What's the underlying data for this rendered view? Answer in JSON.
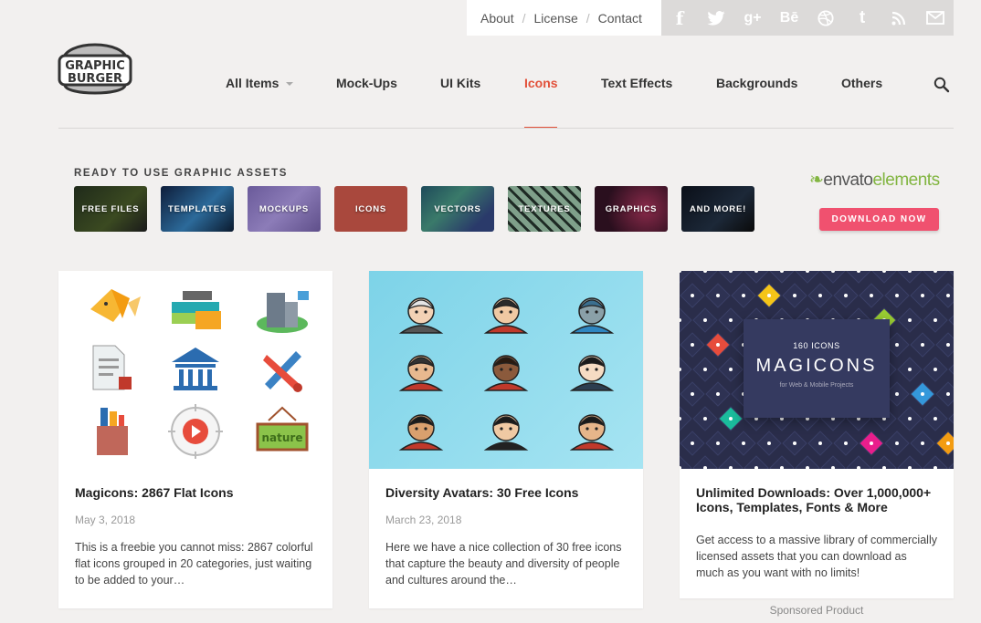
{
  "top_links": [
    "About",
    "License",
    "Contact"
  ],
  "social_icons": [
    "facebook-icon",
    "twitter-icon",
    "google-plus-icon",
    "behance-icon",
    "dribbble-icon",
    "tumblr-icon",
    "rss-icon",
    "email-icon"
  ],
  "social_glyphs": [
    "f",
    "t",
    "g+",
    "Bē",
    "⊛",
    "t",
    ")",
    "✉"
  ],
  "logo": {
    "line1": "GRAPHIC",
    "line2": "BURGER"
  },
  "nav": {
    "items": [
      "All Items",
      "Mock-Ups",
      "UI Kits",
      "Icons",
      "Text Effects",
      "Backgrounds",
      "Others"
    ],
    "active": "Icons"
  },
  "assets": {
    "title": "READY TO USE GRAPHIC ASSETS",
    "tiles": [
      "FREE FILES",
      "TEMPLATES",
      "MOCKUPS",
      "ICONS",
      "VECTORS",
      "TEXTURES",
      "GRAPHICS",
      "AND MORE!"
    ]
  },
  "envato": {
    "brand": "envato",
    "suffix": "elements",
    "cta": "DOWNLOAD NOW"
  },
  "cards": [
    {
      "title": "Magicons: 2867 Flat Icons",
      "date": "May 3, 2018",
      "excerpt": "This is a freebie you cannot miss: 2867 colorful flat icons grouped in 20 categories, just waiting to be added to your…"
    },
    {
      "title": "Diversity Avatars: 30 Free Icons",
      "date": "March 23, 2018",
      "excerpt": "Here we have a nice collection of 30 free icons that capture the beauty and diversity of people and cultures around the…"
    },
    {
      "title": "Unlimited Downloads: Over 1,000,000+ Icons, Templates, Fonts & More",
      "date": "",
      "excerpt": "Get access to a massive library of commercially licensed assets that you can download as much as you want with no limits!",
      "promo_count": "160 ICONS",
      "promo_title": "MAGICONS",
      "promo_sub": "for Web & Mobile Projects"
    }
  ],
  "sponsored": "Sponsored Product",
  "colors": {
    "accent": "#e2513a",
    "cta": "#f0516f",
    "envato_green": "#82b541",
    "page_bg": "#f2f0ef"
  }
}
